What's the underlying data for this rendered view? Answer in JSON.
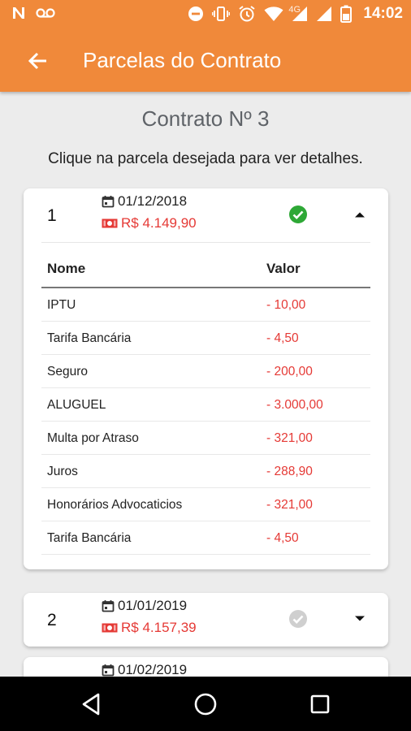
{
  "status_bar": {
    "time": "14:02",
    "network": "4G",
    "left_icons": [
      "n-notification-icon",
      "voicemail-icon"
    ],
    "right_icons": [
      "do-not-disturb-icon",
      "vibrate-icon",
      "alarm-icon",
      "wifi-icon",
      "signal-icon",
      "signal-icon",
      "battery-icon"
    ]
  },
  "app_bar": {
    "title": "Parcelas do Contrato",
    "back_icon": "arrow-left-icon"
  },
  "contract_title": "Contrato Nº 3",
  "instructions": "Clique na parcela desejada para ver detalhes.",
  "installments": [
    {
      "number": "1",
      "date": "01/12/2018",
      "amount": "R$ 4.149,90",
      "paid": true,
      "expanded": true,
      "table": {
        "col_name": "Nome",
        "col_value": "Valor",
        "rows": [
          {
            "name": "IPTU",
            "value": "- 10,00"
          },
          {
            "name": "Tarifa Bancária",
            "value": "- 4,50"
          },
          {
            "name": "Seguro",
            "value": "- 200,00"
          },
          {
            "name": "ALUGUEL",
            "value": "- 3.000,00"
          },
          {
            "name": "Multa por Atraso",
            "value": "- 321,00"
          },
          {
            "name": "Juros",
            "value": "- 288,90"
          },
          {
            "name": "Honorários Advocaticios",
            "value": "- 321,00"
          },
          {
            "name": "Tarifa Bancária",
            "value": "- 4,50"
          }
        ]
      }
    },
    {
      "number": "2",
      "date": "01/01/2019",
      "amount": "R$ 4.157,39",
      "paid": false,
      "expanded": false
    },
    {
      "number": "3",
      "date": "01/02/2019",
      "amount": "",
      "paid": false,
      "expanded": false
    }
  ],
  "colors": {
    "primary": "#f0893a",
    "negative": "#e53935",
    "paid_green": "#2ea836",
    "unpaid_grey": "#cfcfcf"
  }
}
